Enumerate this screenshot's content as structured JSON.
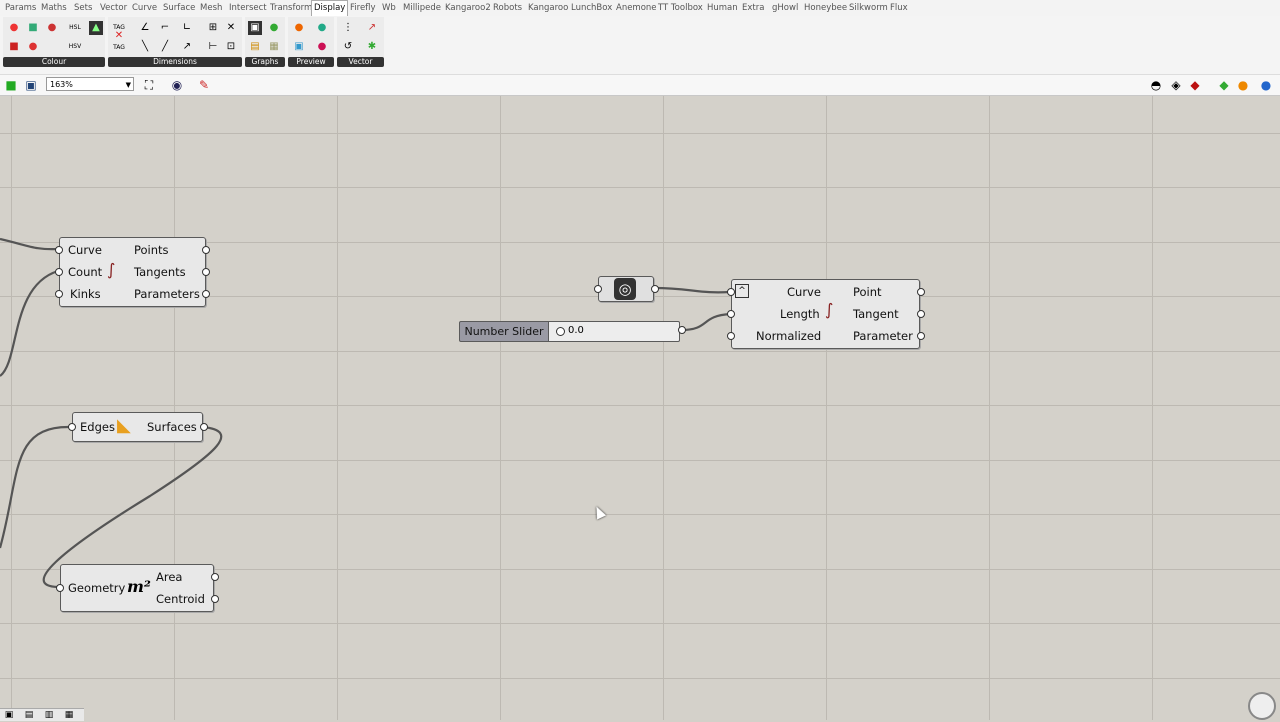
{
  "menu_tabs": [
    "Params",
    "Maths",
    "Sets",
    "Vector",
    "Curve",
    "Surface",
    "Mesh",
    "Intersect",
    "Transform",
    "Display",
    "Firefly",
    "Wb",
    "Millipede",
    "Kangaroo2",
    "Robots",
    "Kangaroo",
    "LunchBox",
    "Anemone",
    "TT Toolbox",
    "Human",
    "Extra",
    "gHowl",
    "Honeybee",
    "Silkworm",
    "Flux"
  ],
  "active_tab": "Display",
  "ribbon_panels": [
    "Colour",
    "Dimensions",
    "Graphs",
    "Preview",
    "Vector"
  ],
  "ribbon_icon_text": {
    "hsl": "HSL",
    "hsv": "HSV",
    "tag1": "TAG",
    "tag2": "TAG"
  },
  "zoom": "163%",
  "components": {
    "divide_curve": {
      "inputs": [
        "Curve",
        "Count",
        "Kinks"
      ],
      "outputs": [
        "Points",
        "Tangents",
        "Parameters"
      ]
    },
    "brep_edges": {
      "inputs": [
        "Edges"
      ],
      "outputs": [
        "Surfaces"
      ]
    },
    "area": {
      "inputs": [
        "Geometry"
      ],
      "outputs": [
        "Area",
        "Centroid"
      ],
      "icon_text": "m²"
    },
    "evaluate_length": {
      "inputs": [
        "Curve",
        "Length",
        "Normalized"
      ],
      "outputs": [
        "Point",
        "Tangent",
        "Parameter"
      ]
    },
    "number_slider": {
      "label": "Number Slider",
      "value": "0.0"
    }
  },
  "colors": {
    "canvas": "#d4d1ca",
    "grid": "#bdb9b2",
    "component": "#e8e8e8",
    "wire": "#555555",
    "slider_label": "#9a9aa4"
  }
}
